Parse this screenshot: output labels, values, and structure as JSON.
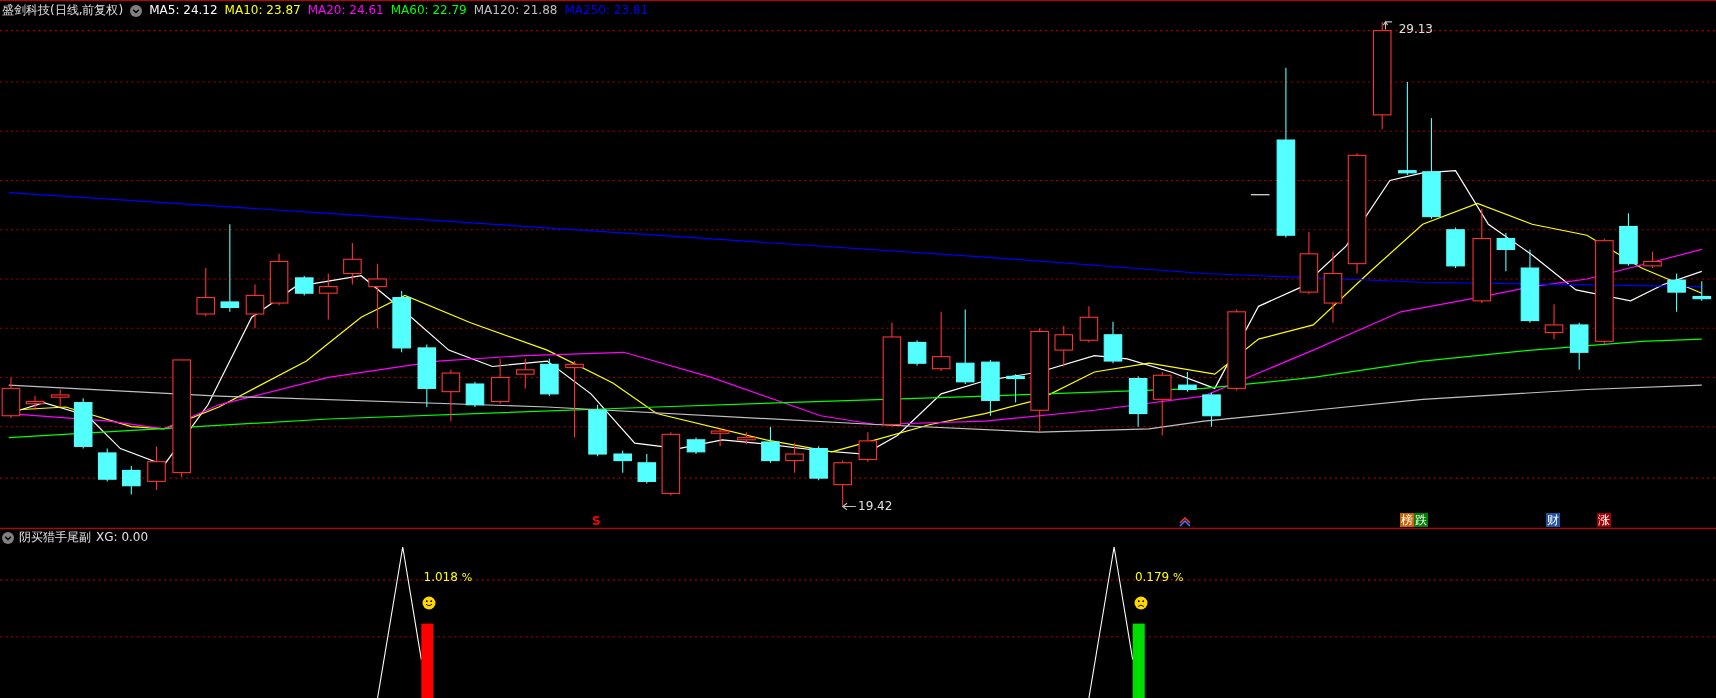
{
  "header": {
    "stock": "盛剑科技(日线,前复权)",
    "indicators": [
      {
        "label": "MA5: 24.12",
        "color": "#ffffff"
      },
      {
        "label": "MA10: 23.87",
        "color": "#ffff00"
      },
      {
        "label": "MA20: 24.61",
        "color": "#ff00ff"
      },
      {
        "label": "MA60: 22.79",
        "color": "#00ff00"
      },
      {
        "label": "MA120: 21.88",
        "color": "#c0c0c0"
      },
      {
        "label": "MA250: 23.81",
        "color": "#0000ff"
      }
    ]
  },
  "main_chart": {
    "high_label": "29.13",
    "low_label": "19.42",
    "markers": [
      {
        "kind": "letter",
        "text": "S",
        "color": "#ff0000"
      },
      {
        "kind": "arrow"
      },
      {
        "kind": "tag",
        "parts": [
          {
            "text": "榜",
            "color": "#c86400"
          },
          {
            "text": "跌",
            "color": "#008000"
          }
        ]
      },
      {
        "kind": "tag",
        "parts": [
          {
            "text": "财",
            "color": "#2050a0"
          }
        ]
      },
      {
        "kind": "tag",
        "parts": [
          {
            "text": "涨",
            "color": "#a00000"
          }
        ]
      }
    ]
  },
  "sub_panel": {
    "title": "阴买猎手尾副",
    "value": "XG: 0.00",
    "signals": [
      {
        "percent": "1.018",
        "unit": "%",
        "kind": "happy",
        "color": "#ff0000"
      },
      {
        "percent": "0.179",
        "unit": "%",
        "kind": "sad",
        "color": "#00dd00"
      }
    ]
  }
}
